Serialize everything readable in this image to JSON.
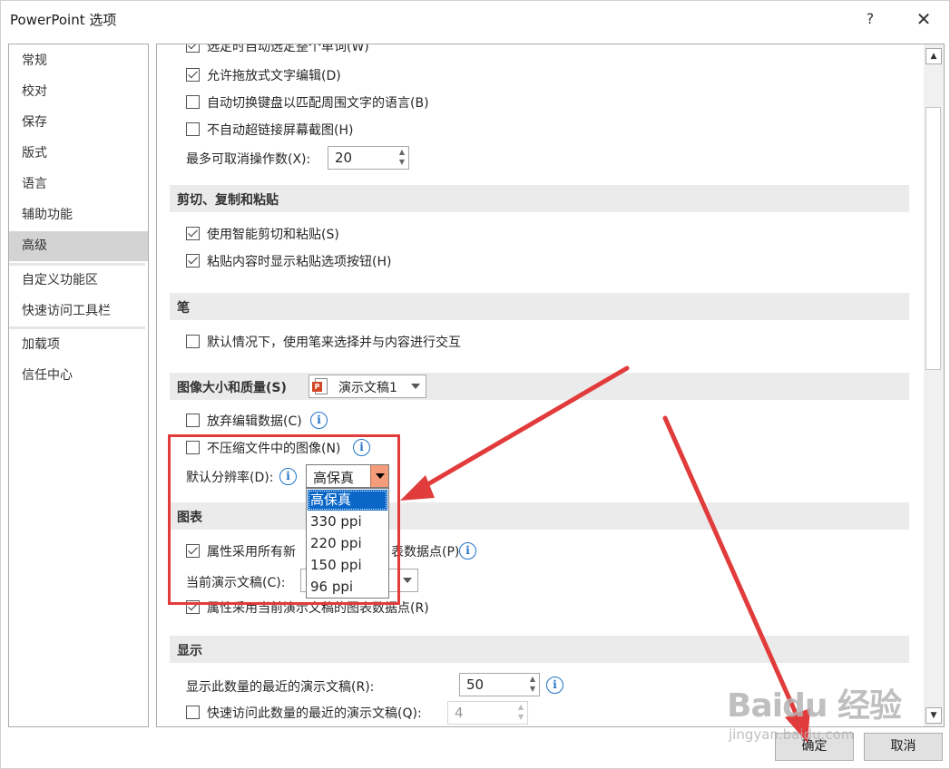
{
  "window": {
    "title": "PowerPoint 选项",
    "help": "?",
    "close": "✕"
  },
  "sidebar": {
    "items": [
      {
        "label": "常规"
      },
      {
        "label": "校对"
      },
      {
        "label": "保存"
      },
      {
        "label": "版式"
      },
      {
        "label": "语言"
      },
      {
        "label": "辅助功能"
      },
      {
        "label": "高级",
        "active": true
      },
      {
        "label": "自定义功能区"
      },
      {
        "label": "快速访问工具栏"
      },
      {
        "label": "加载项"
      },
      {
        "label": "信任中心"
      }
    ]
  },
  "editing": {
    "auto_select_word": {
      "label": "选定时自动选定整个单词(W)",
      "checked": true
    },
    "allow_drag_drop": {
      "label": "允许拖放式文字编辑(D)",
      "checked": true
    },
    "auto_keyboard": {
      "label": "自动切换键盘以匹配周围文字的语言(B)",
      "checked": false
    },
    "no_hyperlink_screenshot": {
      "label": "不自动超链接屏幕截图(H)",
      "checked": false
    },
    "max_undo_label": "最多可取消操作数(X):",
    "max_undo_value": "20"
  },
  "cut_copy_paste": {
    "title": "剪切、复制和粘贴",
    "smart_cut": {
      "label": "使用智能剪切和粘贴(S)",
      "checked": true
    },
    "show_paste_options": {
      "label": "粘贴内容时显示粘贴选项按钮(H)",
      "checked": true
    }
  },
  "pen": {
    "title": "笔",
    "use_pen": {
      "label": "默认情况下，使用笔来选择并与内容进行交互",
      "checked": false
    }
  },
  "image_quality": {
    "title": "图像大小和质量(S)",
    "document": "演示文稿1",
    "discard_edit_data": {
      "label": "放弃编辑数据(C)",
      "checked": false
    },
    "no_compress": {
      "label": "不压缩文件中的图像(N)",
      "checked": false
    },
    "default_res_label": "默认分辨率(D):",
    "default_res_value": "高保真",
    "options": [
      "高保真",
      "330 ppi",
      "220 ppi",
      "150 ppi",
      "96 ppi"
    ],
    "selected_index": 0
  },
  "chart": {
    "title": "图表",
    "properties_all": {
      "label_left": "属性采用所有新",
      "label_right": "表数据点(P)",
      "checked": true
    },
    "current_pres_label": "当前演示文稿(C):",
    "properties_current": {
      "label": "属性采用当前演示文稿的图表数据点(R)",
      "checked": true
    }
  },
  "display": {
    "title": "显示",
    "recent_count_label": "显示此数量的最近的演示文稿(R):",
    "recent_count_value": "50",
    "quick_access": {
      "label": "快速访问此数量的最近的演示文稿(Q):",
      "checked": false
    },
    "quick_access_value": "4"
  },
  "footer": {
    "ok": "确定",
    "cancel": "取消"
  },
  "watermark": {
    "logo": "Baidu 经验",
    "url": "jingyan.baidu.com"
  },
  "colors": {
    "highlight": "#e23b3b",
    "selection": "#0a67c8",
    "dropdown_button": "#f59d7a"
  }
}
